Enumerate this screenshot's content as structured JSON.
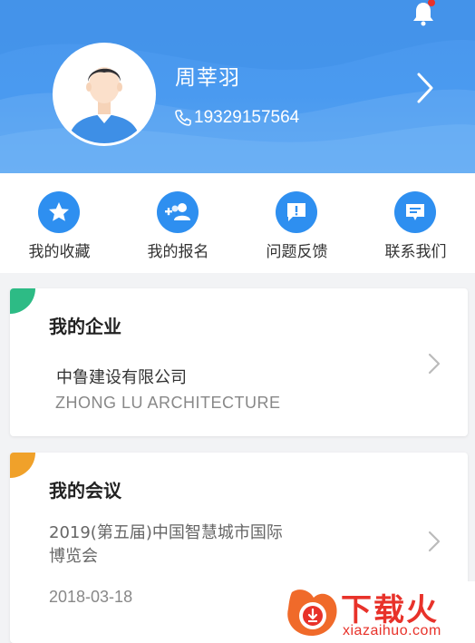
{
  "profile": {
    "name": "周莘羽",
    "phone": "19329157564",
    "has_notification": true
  },
  "actions": [
    {
      "label": "我的收藏",
      "icon": "star-icon"
    },
    {
      "label": "我的报名",
      "icon": "add-user-icon"
    },
    {
      "label": "问题反馈",
      "icon": "feedback-icon"
    },
    {
      "label": "联系我们",
      "icon": "message-icon"
    }
  ],
  "company": {
    "title": "我的企业",
    "name": "中鲁建设有限公司",
    "name_en": "ZHONG LU ARCHITECTURE"
  },
  "meeting": {
    "title": "我的会议",
    "name": "2019(第五届)中国智慧城市国际博览会",
    "date": "2018-03-18"
  },
  "watermark": {
    "title": "下载火",
    "subtitle": "xiazaihuo.com"
  },
  "colors": {
    "header_blue": "#4a9af0",
    "action_blue": "#2e8ff0",
    "company_accent": "#2dbb85",
    "meeting_accent": "#f0a12a",
    "notification_dot": "#e8322a"
  }
}
